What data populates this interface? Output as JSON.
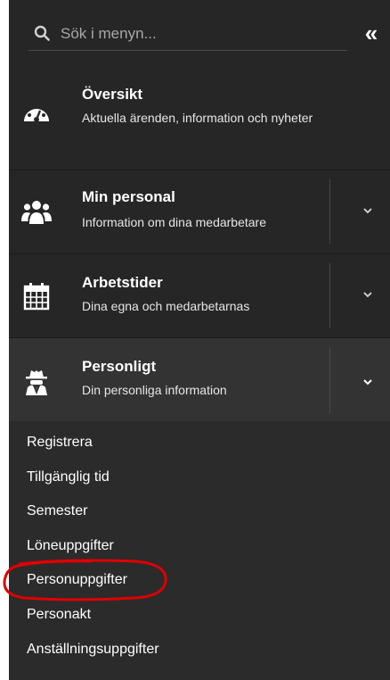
{
  "search": {
    "placeholder": "Sök i menyn..."
  },
  "collapse_glyph": "«",
  "sections": [
    {
      "title": "Översikt",
      "subtitle": "Aktuella ärenden, information och nyheter",
      "icon": "dashboard-gauge-icon",
      "expandable": false
    },
    {
      "title": "Min personal",
      "subtitle": "Information om dina medarbetare",
      "icon": "users-group-icon",
      "expandable": true
    },
    {
      "title": "Arbetstider",
      "subtitle": "Dina egna och medarbetarnas",
      "icon": "calendar-icon",
      "expandable": true
    },
    {
      "title": "Personligt",
      "subtitle": "Din personliga information",
      "icon": "user-secret-icon",
      "expandable": true,
      "expanded": true
    }
  ],
  "personligt_items": [
    "Registrera",
    "Tillgänglig tid",
    "Semester",
    "Löneuppgifter",
    "Personuppgifter",
    "Personakt",
    "Anställningsuppgifter"
  ],
  "highlight_color": "#e00000"
}
